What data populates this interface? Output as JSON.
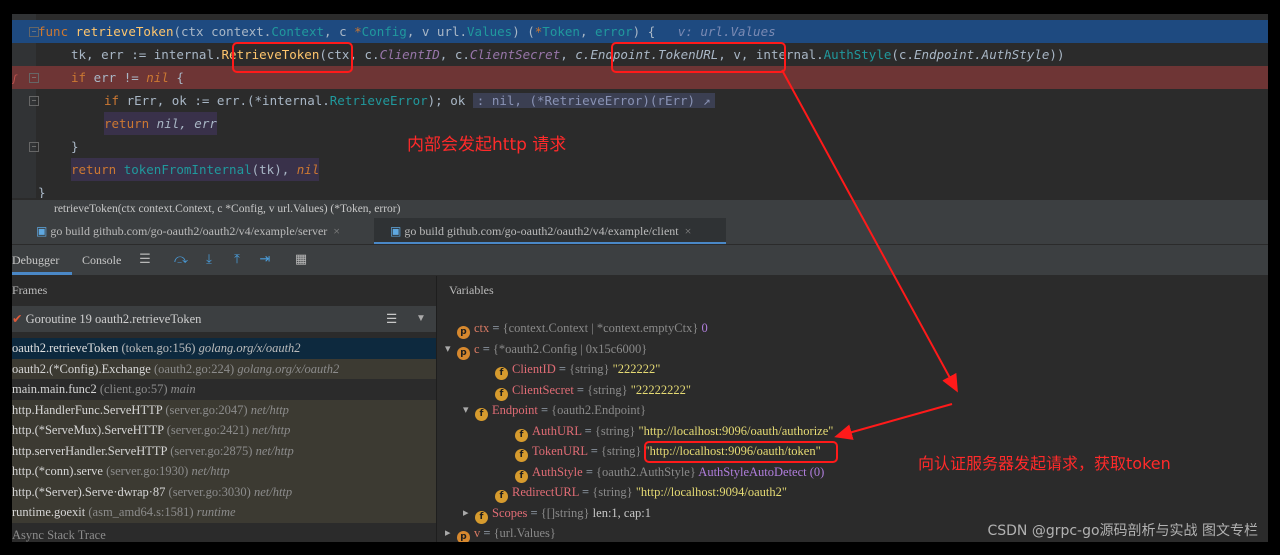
{
  "editor": {
    "line1": {
      "kw": "func",
      "name": "retrieveToken",
      "sig": "(ctx context.",
      "t1": "Context",
      "s2": ", c ",
      "star": "*",
      "t2": "Config",
      "s3": ", v url.",
      "t3": "Values",
      "s4": ") (",
      "t4": "Token",
      "s5": ", ",
      "t5": "error",
      "s6": ") {",
      "hint": "v: url.Values"
    },
    "line2": {
      "a": "tk, err := internal.",
      "fn": "RetrieveToken",
      "b": "(ctx, c.",
      "c1": "ClientID",
      "c2": ", c.",
      "c3": "ClientSecret",
      "c4": ", ",
      "c5": "c.Endpoint.TokenURL",
      "c6": ", v, internal.",
      "c7": "AuthStyle",
      "c8": "(c.",
      "c9": "Endpoint.AuthStyle",
      "c10": "))"
    },
    "line3": {
      "kw": "if",
      "a": " err != ",
      "nil": "nil",
      "b": " {"
    },
    "line4": {
      "kw": "if",
      "a": " rErr, ok := err.(*internal.",
      "ty": "RetrieveError",
      "b": "); ok",
      "hint": ": nil, (*RetrieveError)(rErr)"
    },
    "line5": {
      "kw": "return",
      "a": " nil, err"
    },
    "line6": {
      "a": "}"
    },
    "line7": {
      "kw": "return",
      "fn": "tokenFromInternal",
      "a": "(tk), ",
      "nil": "nil"
    },
    "line8": {
      "a": "}"
    }
  },
  "signature": "retrieveToken(ctx context.Context, c *Config, v url.Values) (*Token, error)",
  "run_tabs": [
    {
      "label": "go build github.com/go-oauth2/oauth2/v4/example/server",
      "close": "×"
    },
    {
      "label": "go build github.com/go-oauth2/oauth2/v4/example/client",
      "close": "×"
    }
  ],
  "debug_tabs": {
    "debugger": "Debugger",
    "console": "Console"
  },
  "frames": {
    "header": "Frames",
    "goroutine": "Goroutine 19 oauth2.retrieveToken",
    "items": [
      {
        "name": "oauth2.retrieveToken",
        "loc": "(token.go:156)",
        "pkg": "golang.org/x/oauth2"
      },
      {
        "name": "oauth2.(*Config).Exchange",
        "loc": "(oauth2.go:224)",
        "pkg": "golang.org/x/oauth2"
      },
      {
        "name": "main.main.func2",
        "loc": "(client.go:57)",
        "pkg": "main"
      },
      {
        "name": "http.HandlerFunc.ServeHTTP",
        "loc": "(server.go:2047)",
        "pkg": "net/http"
      },
      {
        "name": "http.(*ServeMux).ServeHTTP",
        "loc": "(server.go:2421)",
        "pkg": "net/http"
      },
      {
        "name": "http.serverHandler.ServeHTTP",
        "loc": "(server.go:2875)",
        "pkg": "net/http"
      },
      {
        "name": "http.(*conn).serve",
        "loc": "(server.go:1930)",
        "pkg": "net/http"
      },
      {
        "name": "http.(*Server).Serve·dwrap·87",
        "loc": "(server.go:3030)",
        "pkg": "net/http"
      },
      {
        "name": "runtime.goexit",
        "loc": "(asm_amd64.s:1581)",
        "pkg": "runtime"
      }
    ],
    "async": "Async Stack Trace"
  },
  "variables": {
    "header": "Variables",
    "rows": [
      {
        "badge": "p",
        "name": "ctx",
        "type": "{context.Context | *context.emptyCtx}",
        "value": "0"
      },
      {
        "badge": "p",
        "name": "c",
        "type": "{*oauth2.Config | 0x15c6000}",
        "value": ""
      },
      {
        "badge": "f",
        "name": "ClientID",
        "type": "{string}",
        "value": "\"222222\""
      },
      {
        "badge": "f",
        "name": "ClientSecret",
        "type": "{string}",
        "value": "\"22222222\""
      },
      {
        "badge": "f",
        "name": "Endpoint",
        "type": "{oauth2.Endpoint}",
        "value": ""
      },
      {
        "badge": "f",
        "name": "AuthURL",
        "type": "{string}",
        "value": "\"http://localhost:9096/oauth/authorize\""
      },
      {
        "badge": "f",
        "name": "TokenURL",
        "type": "{string}",
        "value": "\"http://localhost:9096/oauth/token\""
      },
      {
        "badge": "f",
        "name": "AuthStyle",
        "type": "{oauth2.AuthStyle}",
        "value": "AuthStyleAutoDetect (0)"
      },
      {
        "badge": "f",
        "name": "RedirectURL",
        "type": "{string}",
        "value": "\"http://localhost:9094/oauth2\""
      },
      {
        "badge": "f",
        "name": "Scopes",
        "type": "{[]string}",
        "value": "len:1, cap:1"
      },
      {
        "badge": "p",
        "name": "v",
        "type": "{url.Values}",
        "value": ""
      }
    ]
  },
  "annotations": {
    "internal_http": "内部会发起http 请求",
    "to_auth_server": "向认证服务器发起请求，获取token"
  },
  "watermark": "CSDN @grpc-go源码剖析与实战 图文专栏",
  "colors": {
    "annotation": "#ff1a1a",
    "exec_line": "#1e4a80",
    "breakpoint_line": "#6e3535"
  }
}
